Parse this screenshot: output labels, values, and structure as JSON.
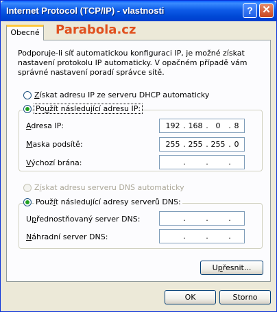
{
  "window": {
    "title": "Internet Protocol (TCP/IP) - vlastnosti",
    "help_glyph": "?",
    "close_glyph": "✕"
  },
  "tab": {
    "label": "Obecné"
  },
  "brand": {
    "text": "Parabola.cz",
    "color": "#E0501E"
  },
  "description": "Podporuje-li síť automatickou konfiguraci IP, je možné získat nastavení protokolu IP automaticky. V opačném případě vám správné nastavení poradí správce sítě.",
  "ip": {
    "auto_option": {
      "pre": "",
      "key": "Z",
      "post": "ískat adresu IP ze serveru DHCP automaticky",
      "selected": false
    },
    "manual_option": {
      "pre": "Po",
      "key": "u",
      "post": "žít následující adresu IP:",
      "selected": true
    },
    "fields": [
      {
        "pre": "",
        "key": "A",
        "post": "dresa IP:",
        "octets": [
          "192",
          "168",
          "0",
          "8"
        ]
      },
      {
        "pre": "",
        "key": "M",
        "post": "aska podsítě:",
        "octets": [
          "255",
          "255",
          "255",
          "0"
        ]
      },
      {
        "pre": "",
        "key": "V",
        "post": "ýchozí brána:",
        "octets": [
          "",
          "",
          "",
          ""
        ]
      }
    ]
  },
  "dns": {
    "auto_option": {
      "pre": "Z",
      "key": "í",
      "post": "skat adresu serveru DNS automaticky",
      "selected": false,
      "disabled": true
    },
    "manual_option": {
      "pre": "Použ",
      "key": "í",
      "post": "t následující adresy serverů DNS:",
      "selected": true
    },
    "fields": [
      {
        "pre": "U",
        "key": "p",
        "post": "řednostňovaný server DNS:",
        "octets": [
          "",
          "",
          "",
          ""
        ]
      },
      {
        "pre": "",
        "key": "N",
        "post": "áhradní server DNS:",
        "octets": [
          "",
          "",
          "",
          ""
        ]
      }
    ]
  },
  "advanced_button": {
    "pre": "U",
    "key": "p",
    "post": "řesnit..."
  },
  "ok_button": "OK",
  "cancel_button": "Storno",
  "octet_separator": "."
}
